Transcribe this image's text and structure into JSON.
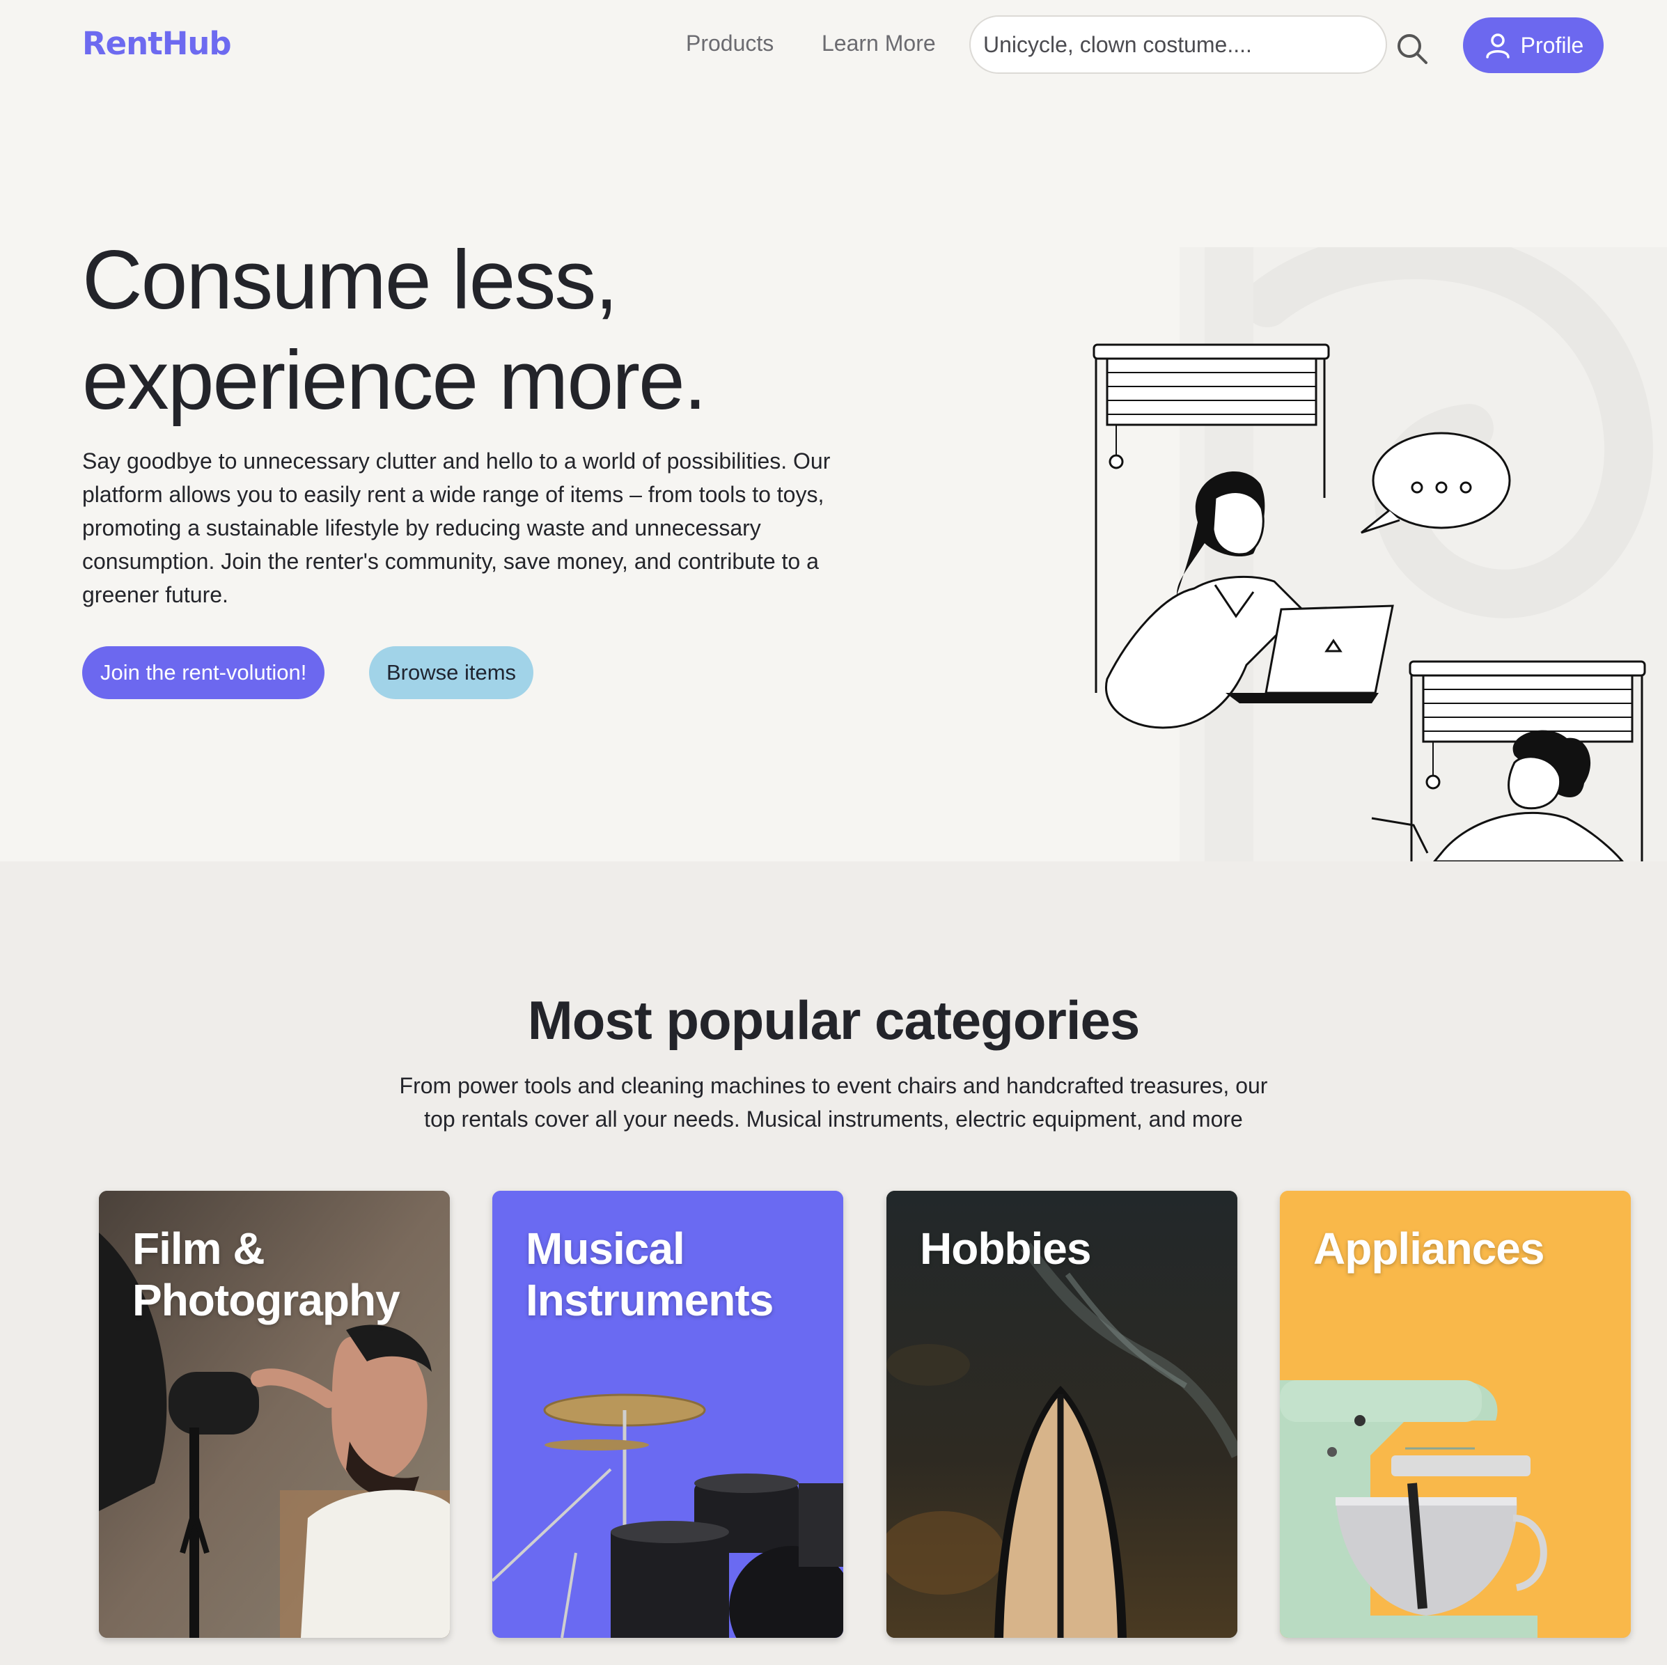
{
  "brand": {
    "logo": "RentHub",
    "accent": "#6c68ef",
    "secondary": "#a1d3e8"
  },
  "nav": {
    "products": "Products",
    "learn_more": "Learn More",
    "search_placeholder": "Unicycle, clown costume....",
    "profile_label": "Profile"
  },
  "hero": {
    "title": "Consume less, experience more.",
    "body": "Say goodbye to unnecessary clutter and hello to a world of possibilities. Our platform allows you to easily rent a wide range of items – from tools to toys, promoting a sustainable lifestyle by reducing waste and unnecessary consumption. Join the renter's community, save money, and contribute to a greener future.",
    "cta_primary": "Join the rent-volution!",
    "cta_secondary": "Browse items"
  },
  "categories": {
    "title": "Most popular categories",
    "subtitle": "From power tools and cleaning machines to event chairs and handcrafted treasures, our top rentals cover all your needs. Musical instruments, electric equipment, and more",
    "items": [
      {
        "label": "Film & Photography",
        "icon": "photographer-image",
        "color": "#5b5048"
      },
      {
        "label": "Musical Instruments",
        "icon": "drum-kit-image",
        "color": "#6a6af2"
      },
      {
        "label": "Hobbies",
        "icon": "surfboard-image",
        "color": "#1f2420"
      },
      {
        "label": "Appliances",
        "icon": "stand-mixer-image",
        "color": "#f9b84a"
      }
    ]
  }
}
